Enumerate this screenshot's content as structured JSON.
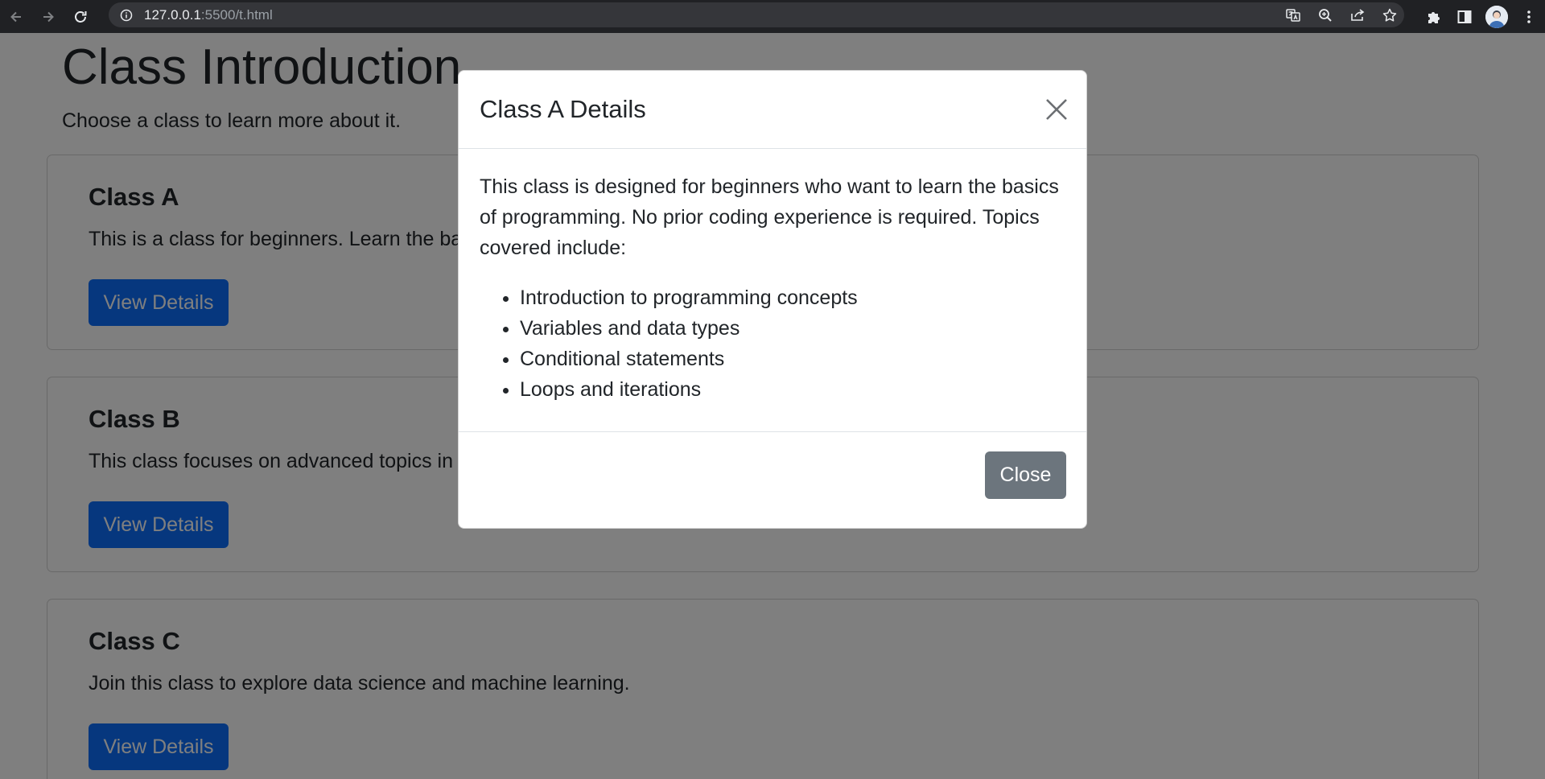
{
  "browser": {
    "url_host": "127.0.0.1",
    "url_rest": ":5500/t.html"
  },
  "page": {
    "title": "Class Introduction",
    "subtitle": "Choose a class to learn more about it."
  },
  "cards": [
    {
      "title": "Class A",
      "text": "This is a class for beginners. Learn the basics of programming.",
      "button": "View Details"
    },
    {
      "title": "Class B",
      "text": "This class focuses on advanced topics in web development.",
      "button": "View Details"
    },
    {
      "title": "Class C",
      "text": "Join this class to explore data science and machine learning.",
      "button": "View Details"
    }
  ],
  "modal": {
    "title": "Class A Details",
    "description": "This class is designed for beginners who want to learn the basics of programming. No prior coding experience is required. Topics covered include:",
    "topics": [
      "Introduction to programming concepts",
      "Variables and data types",
      "Conditional statements",
      "Loops and iterations"
    ],
    "close_label": "Close"
  },
  "colors": {
    "primary": "#0d6efd",
    "secondary": "#6c757d",
    "chrome_bg": "#202124",
    "omnibox_bg": "#35363a"
  },
  "icons": {
    "back": "back-arrow-icon",
    "forward": "forward-arrow-icon",
    "reload": "reload-icon",
    "site_info": "info-icon",
    "translate": "translate-icon",
    "zoom": "zoom-icon",
    "share": "share-icon",
    "bookmark": "star-icon",
    "extensions": "puzzle-icon",
    "side_panel": "side-panel-icon",
    "profile": "avatar",
    "menu": "kebab-menu-icon",
    "modal_close": "close-icon"
  }
}
